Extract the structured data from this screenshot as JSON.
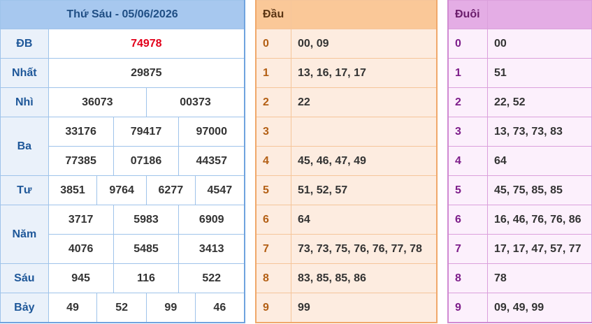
{
  "results": {
    "title": "Thứ Sáu - 05/06/2026",
    "prizes": {
      "db": {
        "label": "ĐB",
        "values": [
          "74978"
        ]
      },
      "nhat": {
        "label": "Nhất",
        "values": [
          "29875"
        ]
      },
      "nhi": {
        "label": "Nhì",
        "values": [
          "36073",
          "00373"
        ]
      },
      "ba": {
        "label": "Ba",
        "values": [
          "33176",
          "79417",
          "97000",
          "77385",
          "07186",
          "44357"
        ]
      },
      "tu": {
        "label": "Tư",
        "values": [
          "3851",
          "9764",
          "6277",
          "4547"
        ]
      },
      "nam": {
        "label": "Năm",
        "values": [
          "3717",
          "5983",
          "6909",
          "4076",
          "5485",
          "3413"
        ]
      },
      "sau": {
        "label": "Sáu",
        "values": [
          "945",
          "116",
          "522"
        ]
      },
      "bay": {
        "label": "Bảy",
        "values": [
          "49",
          "52",
          "99",
          "46"
        ]
      }
    }
  },
  "dau": {
    "header": "Đầu",
    "rows": [
      {
        "key": "0",
        "values": "00, 09"
      },
      {
        "key": "1",
        "values": "13, 16, 17, 17"
      },
      {
        "key": "2",
        "values": "22"
      },
      {
        "key": "3",
        "values": ""
      },
      {
        "key": "4",
        "values": "45, 46, 47, 49"
      },
      {
        "key": "5",
        "values": "51, 52, 57"
      },
      {
        "key": "6",
        "values": "64"
      },
      {
        "key": "7",
        "values": "73, 73, 75, 76, 76, 77, 78"
      },
      {
        "key": "8",
        "values": "83, 85, 85, 86"
      },
      {
        "key": "9",
        "values": "99"
      }
    ]
  },
  "duoi": {
    "header": "Đuôi",
    "rows": [
      {
        "key": "0",
        "values": "00"
      },
      {
        "key": "1",
        "values": "51"
      },
      {
        "key": "2",
        "values": "22, 52"
      },
      {
        "key": "3",
        "values": "13, 73, 73, 83"
      },
      {
        "key": "4",
        "values": "64"
      },
      {
        "key": "5",
        "values": "45, 75, 85, 85"
      },
      {
        "key": "6",
        "values": "16, 46, 76, 76, 86"
      },
      {
        "key": "7",
        "values": "17, 17, 47, 57, 77"
      },
      {
        "key": "8",
        "values": "78"
      },
      {
        "key": "9",
        "values": "09, 49, 99"
      }
    ]
  },
  "colors": {
    "special_prize": "#e2001a",
    "results_header": "#a7c8ef",
    "dau_header": "#fac898",
    "duoi_header": "#e4ade5"
  }
}
